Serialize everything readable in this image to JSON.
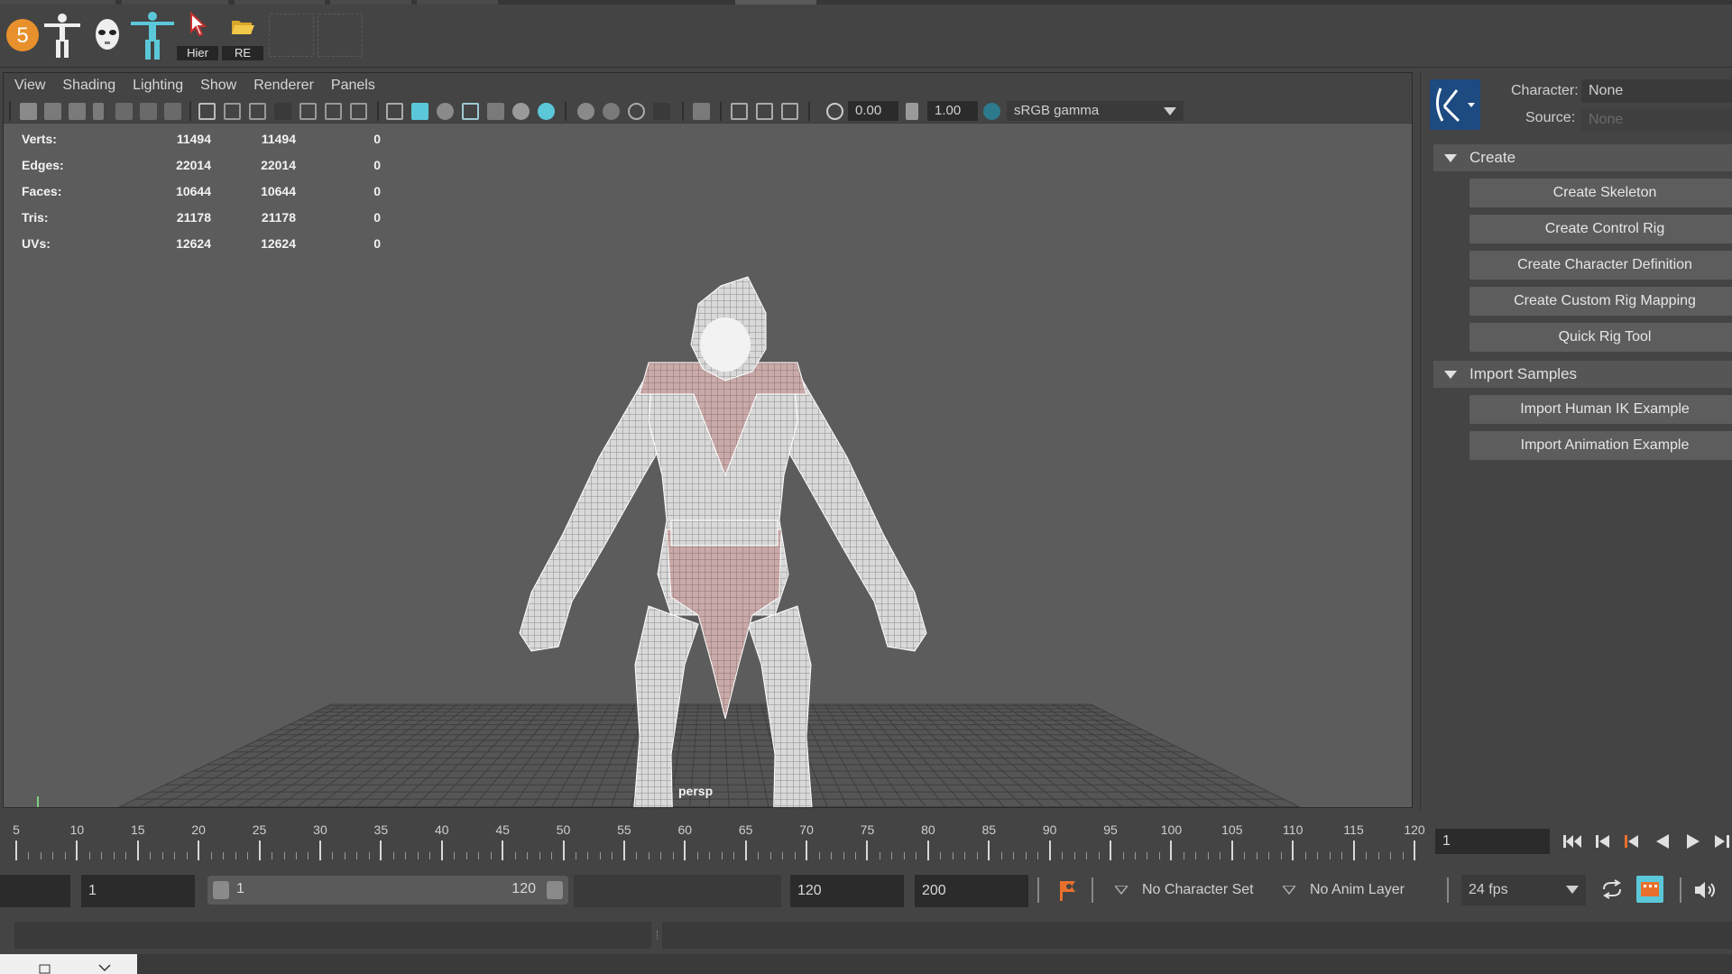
{
  "shelf": {
    "badge": "5",
    "buttons": [
      {
        "label": "Hier",
        "icon": "cursor-select-icon"
      },
      {
        "label": "RE",
        "icon": "folder-open-icon"
      }
    ]
  },
  "viewport": {
    "menus": [
      "View",
      "Shading",
      "Lighting",
      "Show",
      "Renderer",
      "Panels"
    ],
    "exposure": "0.00",
    "gamma": "1.00",
    "color_space": "sRGB gamma",
    "camera": "persp",
    "hud": [
      {
        "key": "Verts:",
        "a": "11494",
        "b": "11494",
        "c": "0"
      },
      {
        "key": "Edges:",
        "a": "22014",
        "b": "22014",
        "c": "0"
      },
      {
        "key": "Faces:",
        "a": "10644",
        "b": "10644",
        "c": "0"
      },
      {
        "key": "Tris:",
        "a": "21178",
        "b": "21178",
        "c": "0"
      },
      {
        "key": "UVs:",
        "a": "12624",
        "b": "12624",
        "c": "0"
      }
    ]
  },
  "hik": {
    "character_label": "Character:",
    "character_value": "None",
    "source_label": "Source:",
    "source_value": "None",
    "create_header": "Create",
    "create_buttons": [
      "Create Skeleton",
      "Create Control Rig",
      "Create Character Definition",
      "Create Custom Rig Mapping",
      "Quick Rig Tool"
    ],
    "import_header": "Import Samples",
    "import_buttons": [
      "Import Human IK Example",
      "Import Animation Example"
    ]
  },
  "timeline": {
    "tick_labels": [
      "5",
      "10",
      "15",
      "20",
      "25",
      "30",
      "35",
      "40",
      "45",
      "50",
      "55",
      "60",
      "65",
      "70",
      "75",
      "80",
      "85",
      "90",
      "95",
      "100",
      "105",
      "110",
      "115",
      "120"
    ],
    "current_frame": "1"
  },
  "range": {
    "start": "1",
    "range_start": "1",
    "range_end": "120",
    "end": "120",
    "anim_end": "200",
    "character_set": "No Character Set",
    "anim_layer": "No Anim Layer",
    "fps": "24 fps"
  },
  "colors": {
    "accent": "#5bc8d9",
    "badge": "#e8902c",
    "key_orange": "#e8702c"
  }
}
